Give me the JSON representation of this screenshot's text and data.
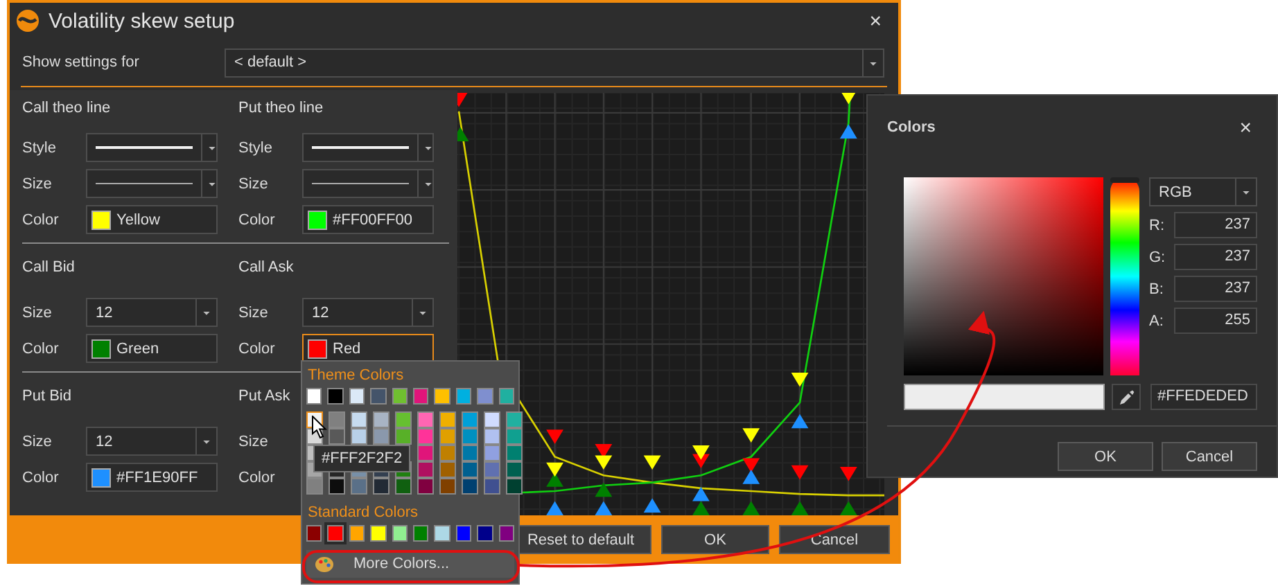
{
  "dialog": {
    "title": "Volatility skew setup",
    "close": "×",
    "show_settings": {
      "label": "Show settings for",
      "value": "< default >"
    },
    "sections": [
      {
        "columns": [
          {
            "title": "Call theo line",
            "rows": [
              {
                "kind": "line-style",
                "label": "Style"
              },
              {
                "kind": "line-size",
                "label": "Size"
              },
              {
                "kind": "color",
                "label": "Color",
                "color": "#ffff00",
                "value": "Yellow",
                "open": false
              }
            ]
          },
          {
            "title": "Put theo line",
            "rows": [
              {
                "kind": "line-style",
                "label": "Style"
              },
              {
                "kind": "line-size",
                "label": "Size"
              },
              {
                "kind": "color",
                "label": "Color",
                "color": "#00ff00",
                "value": "#FF00FF00",
                "open": false
              }
            ]
          }
        ]
      },
      {
        "columns": [
          {
            "title": "Call Bid",
            "rows": [
              {
                "kind": "number",
                "label": "Size",
                "value": "12"
              },
              {
                "kind": "color",
                "label": "Color",
                "color": "#008000",
                "value": "Green",
                "open": false
              }
            ]
          },
          {
            "title": "Call Ask",
            "rows": [
              {
                "kind": "number",
                "label": "Size",
                "value": "12"
              },
              {
                "kind": "color",
                "label": "Color",
                "color": "#ff0000",
                "value": "Red",
                "open": true
              }
            ]
          }
        ]
      },
      {
        "columns": [
          {
            "title": "Put Bid",
            "rows": [
              {
                "kind": "number",
                "label": "Size",
                "value": "12"
              },
              {
                "kind": "color",
                "label": "Color",
                "color": "#1e90ff",
                "value": "#FF1E90FF",
                "open": false
              }
            ]
          },
          {
            "title": "Put Ask",
            "rows": [
              {
                "kind": "covered",
                "label": "Size"
              },
              {
                "kind": "covered",
                "label": "Color"
              }
            ]
          }
        ]
      }
    ],
    "buttons": [
      {
        "label": "Reset to default"
      },
      {
        "label": "OK"
      },
      {
        "label": "Cancel"
      }
    ]
  },
  "popup": {
    "theme_title": "Theme Colors",
    "theme": [
      {
        "color": "#ffffff",
        "shades": [
          {
            "color": "#f2f2f2",
            "hovered": true
          },
          {
            "color": "#d9d9d9",
            "hovered": false
          },
          {
            "color": "#bfbfbf",
            "hovered": false
          },
          {
            "color": "#a6a6a6",
            "hovered": false
          },
          {
            "color": "#808080",
            "hovered": false
          }
        ]
      },
      {
        "color": "#000000",
        "shades": [
          {
            "color": "#808080",
            "hovered": false
          },
          {
            "color": "#595959",
            "hovered": false
          },
          {
            "color": "#262626",
            "hovered": false
          },
          {
            "color": "#0d0d0d",
            "hovered": false
          }
        ]
      },
      {
        "color": "#dbe9f7",
        "shades": [
          {
            "color": "#c6dbef",
            "hovered": false
          },
          {
            "color": "#b8d0e8",
            "hovered": false
          },
          {
            "color": "#7890a8",
            "hovered": false
          },
          {
            "color": "#5a7088",
            "hovered": false
          }
        ]
      },
      {
        "color": "#44546a",
        "shades": [
          {
            "color": "#a8b4c4",
            "hovered": false
          },
          {
            "color": "#8a98ac",
            "hovered": false
          },
          {
            "color": "#333f50",
            "hovered": false
          },
          {
            "color": "#222a35",
            "hovered": false
          }
        ]
      },
      {
        "color": "#70c030",
        "shades": [
          {
            "color": "#66c030",
            "hovered": false
          },
          {
            "color": "#58b028",
            "hovered": false
          },
          {
            "color": "#208010",
            "hovered": false
          },
          {
            "color": "#106010",
            "hovered": false
          }
        ]
      },
      {
        "color": "#e0157a",
        "shades": [
          {
            "color": "#ff66b3",
            "hovered": false
          },
          {
            "color": "#ff3399",
            "hovered": false
          },
          {
            "color": "#e0157a",
            "hovered": false
          },
          {
            "color": "#b01060",
            "hovered": false
          },
          {
            "color": "#800040",
            "hovered": false
          }
        ]
      },
      {
        "color": "#ffc000",
        "shades": [
          {
            "color": "#f0b000",
            "hovered": false
          },
          {
            "color": "#e0a000",
            "hovered": false
          },
          {
            "color": "#c08000",
            "hovered": false
          },
          {
            "color": "#a06000",
            "hovered": false
          },
          {
            "color": "#804000",
            "hovered": false
          }
        ]
      },
      {
        "color": "#00b0e0",
        "shades": [
          {
            "color": "#00a0d8",
            "hovered": false
          },
          {
            "color": "#0090c0",
            "hovered": false
          },
          {
            "color": "#0078a8",
            "hovered": false
          },
          {
            "color": "#006090",
            "hovered": false
          },
          {
            "color": "#004070",
            "hovered": false
          }
        ]
      },
      {
        "color": "#7f8fcf",
        "shades": [
          {
            "color": "#d0dcff",
            "hovered": false
          },
          {
            "color": "#b0c0f0",
            "hovered": false
          },
          {
            "color": "#90a0e0",
            "hovered": false
          },
          {
            "color": "#6070b0",
            "hovered": false
          },
          {
            "color": "#405090",
            "hovered": false
          }
        ]
      },
      {
        "color": "#20b0a0",
        "shades": [
          {
            "color": "#20b0a0",
            "hovered": false
          },
          {
            "color": "#10a090",
            "hovered": false
          },
          {
            "color": "#008070",
            "hovered": false
          },
          {
            "color": "#006050",
            "hovered": false
          },
          {
            "color": "#004030",
            "hovered": false
          }
        ]
      }
    ],
    "tooltip": "#FFF2F2F2",
    "standard_title": "Standard Colors",
    "standard": [
      {
        "color": "#8b0000",
        "selected": false
      },
      {
        "color": "#ff0000",
        "selected": true
      },
      {
        "color": "#ffa500",
        "selected": false
      },
      {
        "color": "#ffff00",
        "selected": false
      },
      {
        "color": "#90ee90",
        "selected": false
      },
      {
        "color": "#008000",
        "selected": false
      },
      {
        "color": "#add8e6",
        "selected": false
      },
      {
        "color": "#0000ff",
        "selected": false
      },
      {
        "color": "#00008b",
        "selected": false
      },
      {
        "color": "#800080",
        "selected": false
      }
    ],
    "more": "More Colors..."
  },
  "colors_dialog": {
    "title": "Colors",
    "close": "×",
    "mode": "RGB",
    "channels": [
      {
        "label": "R:",
        "value": "237"
      },
      {
        "label": "G:",
        "value": "237"
      },
      {
        "label": "B:",
        "value": "237"
      },
      {
        "label": "A:",
        "value": "255"
      }
    ],
    "hue": {
      "level": 0
    },
    "hex": "#FFEDEDED",
    "buttons": [
      {
        "label": "OK"
      },
      {
        "label": "Cancel"
      }
    ]
  }
}
